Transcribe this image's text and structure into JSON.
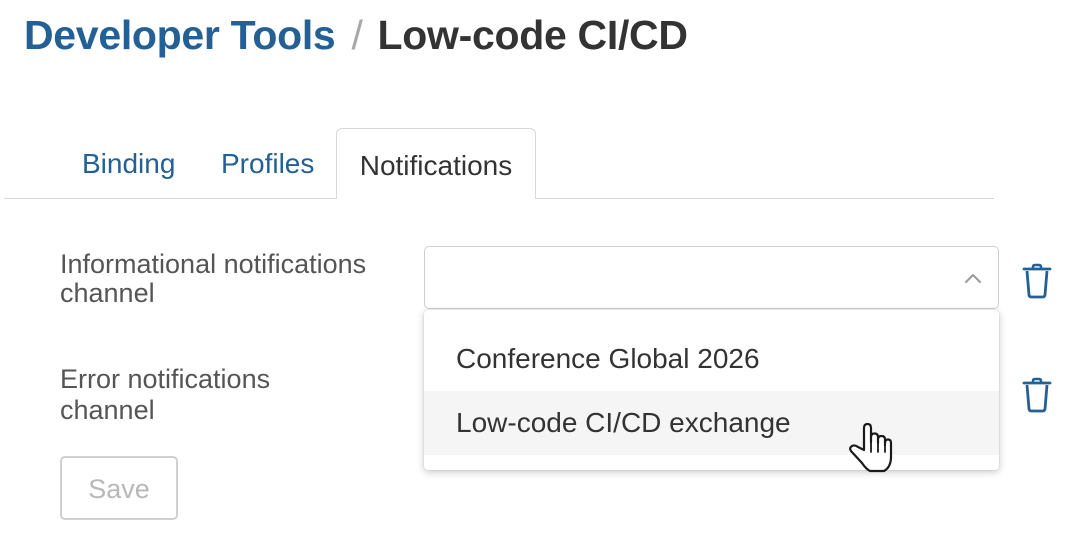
{
  "breadcrumb": {
    "parent": "Developer Tools",
    "separator": "/",
    "current": "Low-code CI/CD"
  },
  "tabs": [
    {
      "label": "Binding",
      "active": false
    },
    {
      "label": "Profiles",
      "active": false
    },
    {
      "label": "Notifications",
      "active": true
    }
  ],
  "form": {
    "info_channel": {
      "label_line1": "Informational notifications",
      "label_line2": "channel",
      "value": "",
      "dropdown_open": true,
      "options": [
        "Conference Global 2026",
        "Low-code CI/CD exchange"
      ],
      "hovered_option": "Low-code CI/CD exchange"
    },
    "error_channel": {
      "label_line1": "Error notifications",
      "label_line2": "channel"
    },
    "save_label": "Save",
    "save_enabled": false
  },
  "icons": {
    "delete": "trash-icon",
    "dropdown": "chevron-up-icon",
    "cursor": "hand-pointer-icon"
  },
  "colors": {
    "link": "#236095",
    "text": "#333333",
    "label": "#555555",
    "disabled": "#b8b8b8",
    "option_hover": "#f5f5f5"
  }
}
